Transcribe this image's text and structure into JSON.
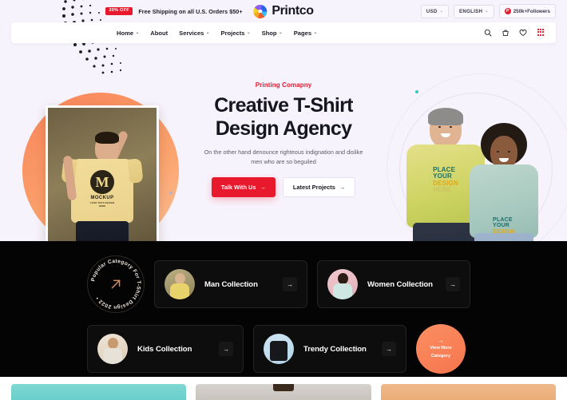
{
  "topbar": {
    "promo_badge": "20% OFF",
    "promo_text": "Free Shipping on all U.S. Orders $50+",
    "logo_text": "Printco",
    "currency": "USD",
    "language": "ENGLISH",
    "followers": "250k+Followers",
    "caret": "⌄"
  },
  "nav": {
    "items": [
      {
        "label": "Home",
        "has_caret": true
      },
      {
        "label": "About",
        "has_caret": false
      },
      {
        "label": "Services",
        "has_caret": true
      },
      {
        "label": "Projects",
        "has_caret": true
      },
      {
        "label": "Shop",
        "has_caret": true
      },
      {
        "label": "Pages",
        "has_caret": true
      }
    ],
    "icons": [
      "search-icon",
      "bag-icon",
      "heart-icon",
      "grid-menu-icon"
    ]
  },
  "hero": {
    "eyebrow": "Printing Comapny",
    "title_line1": "Creative T-Shirt",
    "title_line2": "Design Agency",
    "paragraph": "On the other hand denounce righteous indignation and dislike men who are so beguiled",
    "primary_button": "Talk With Us",
    "secondary_button": "Latest Projects",
    "arrow": "→",
    "left_photo_shirt_logo": "M",
    "left_photo_shirt_text": "MOCKUP",
    "left_photo_shirt_sub": "YOUR TEXT DESIGN HERE",
    "right_shirt_line1": "PLACE",
    "right_shirt_line2": "YOUR",
    "right_shirt_line3": "DESIGN",
    "right_shirt_line4": "HERE"
  },
  "categories": {
    "badge_text": "Popular Category For T-Shirt Design 2022 • ",
    "badge_icon": "arrow-up-right-icon",
    "cards": [
      {
        "label": "Man Collection",
        "avatar": "man-avatar",
        "arrow": "→"
      },
      {
        "label": "Women Collection",
        "avatar": "woman-avatar",
        "arrow": "→"
      },
      {
        "label": "Kids Collection",
        "avatar": "kid-avatar",
        "arrow": "→"
      },
      {
        "label": "Trendy Collection",
        "avatar": "tshirt-avatar",
        "arrow": "→"
      }
    ],
    "view_more_arrow": "→",
    "view_more_line1": "View More",
    "view_more_line2": "Category"
  },
  "colors": {
    "accent_red": "#e8192c",
    "orange": "#f9845a",
    "hero_bg": "#f7f3fc",
    "dark_bg": "#040404"
  }
}
